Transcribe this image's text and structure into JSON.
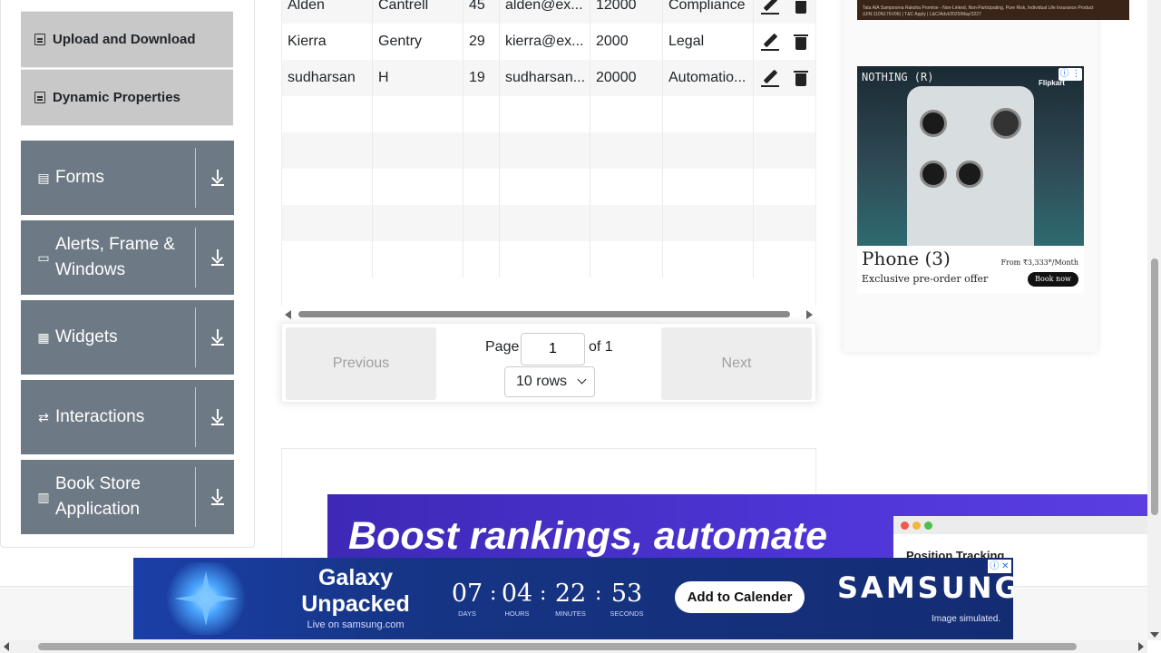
{
  "sidebar": {
    "sub_items": [
      {
        "label": "Upload and Download",
        "icon": "list-icon"
      },
      {
        "label": "Dynamic Properties",
        "icon": "list-icon"
      }
    ],
    "groups": [
      {
        "label": "Forms",
        "icon": "document-icon"
      },
      {
        "label": "Alerts, Frame & Windows",
        "icon": "window-icon"
      },
      {
        "label": "Widgets",
        "icon": "widgets-icon"
      },
      {
        "label": "Interactions",
        "icon": "swap-icon"
      },
      {
        "label": "Book Store Application",
        "icon": "books-icon"
      }
    ]
  },
  "table": {
    "rows": [
      {
        "first": "Alden",
        "last": "Cantrell",
        "age": "45",
        "email": "alden@ex...",
        "salary": "12000",
        "department": "Compliance"
      },
      {
        "first": "Kierra",
        "last": "Gentry",
        "age": "29",
        "email": "kierra@ex...",
        "salary": "2000",
        "department": "Legal"
      },
      {
        "first": "sudharsan",
        "last": "H",
        "age": "19",
        "email": "sudharsan...",
        "salary": "20000",
        "department": "Automatio..."
      }
    ]
  },
  "pagination": {
    "previous": "Previous",
    "next": "Next",
    "page_label": "Page",
    "page_value": "1",
    "of_label": "of 1",
    "rows_label": "10 rows"
  },
  "ads": {
    "top_strip_text": "Tata AIA Sampoorna Raksha Promise - Non-Linked, Non-Participating, Pure Risk, Individual Life Insurance Product (UIN:110N176V06) | T&C Apply | L&C/Advt/2025/May/3227",
    "phone": {
      "brand": "NOTHING (R)",
      "store": "Flipkart",
      "title": "Phone (3)",
      "price": "From ₹3,333*/Month",
      "offer": "Exclusive pre-order offer",
      "cta": "Book now"
    },
    "boost": {
      "headline": "Boost rankings, automate",
      "mock_title": "Position Tracking"
    },
    "samsung": {
      "line1": "Galaxy",
      "line2": "Unpacked",
      "live": "Live on samsung.com",
      "countdown": [
        {
          "value": "07",
          "label": "DAYS"
        },
        {
          "value": "04",
          "label": "HOURS"
        },
        {
          "value": "22",
          "label": "MINUTES"
        },
        {
          "value": "53",
          "label": "SECONDS"
        }
      ],
      "cta": "Add to Calender",
      "logo": "SAMSUNG",
      "disclaimer": "Image simulated."
    }
  }
}
